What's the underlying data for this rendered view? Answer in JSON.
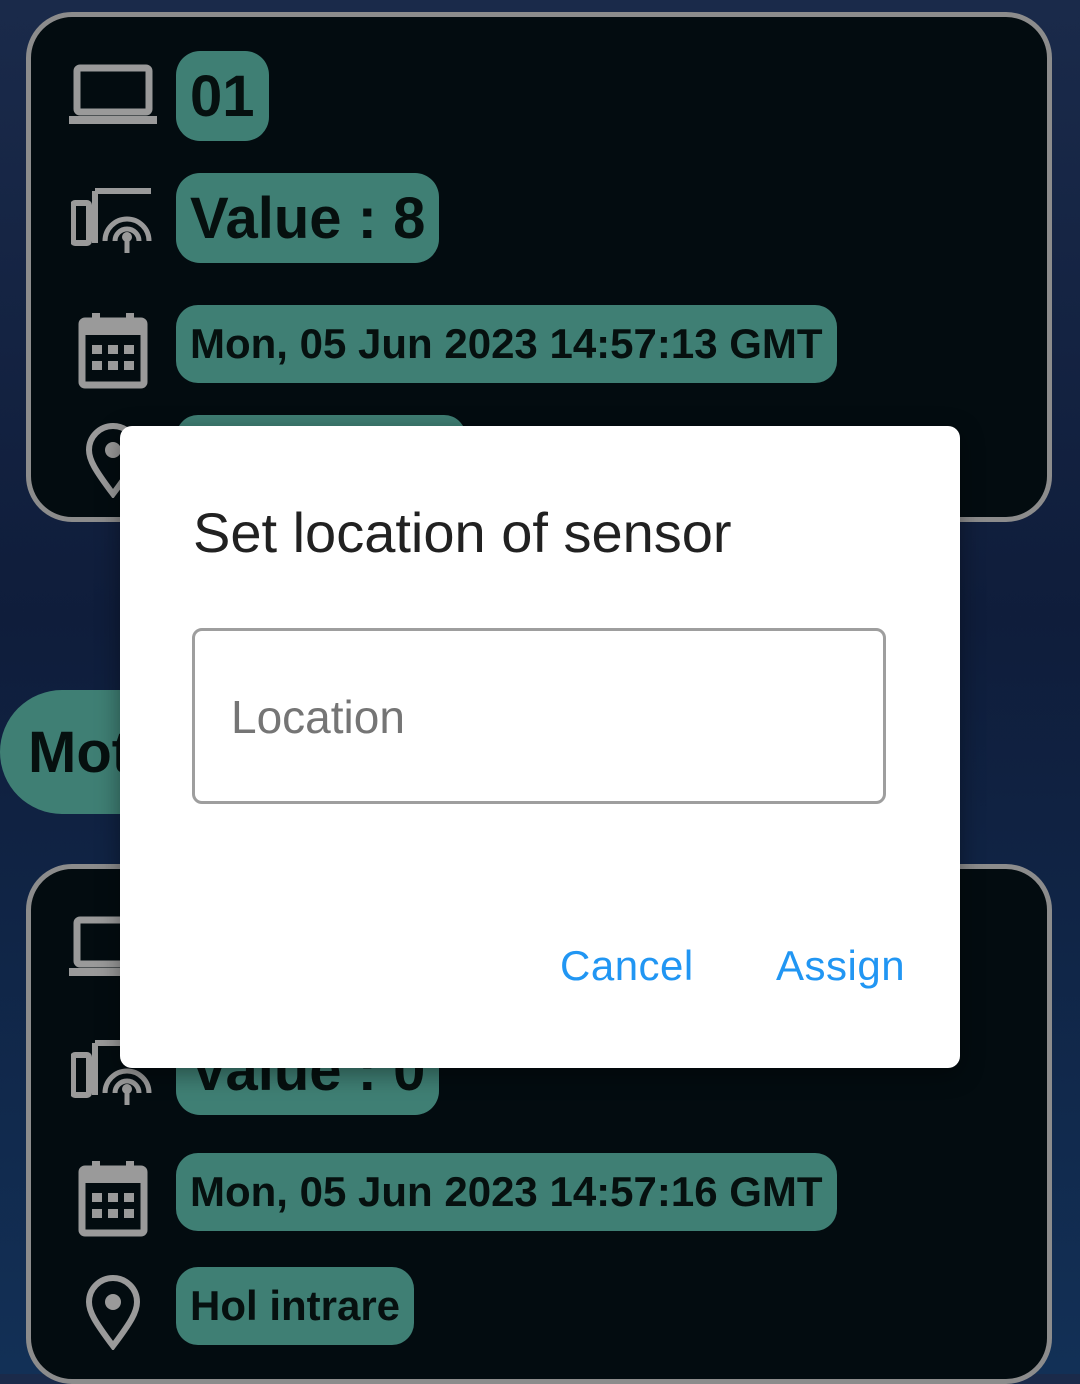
{
  "cards": [
    {
      "id_label": "01",
      "value_label": "Value : 8",
      "timestamp": "Mon, 05 Jun 2023 14:57:13 GMT",
      "location": ""
    },
    {
      "value_label": "Value : 0",
      "timestamp": "Mon, 05 Jun 2023 14:57:16 GMT",
      "location": "Hol intrare"
    }
  ],
  "section_pill": "Mot",
  "dialog": {
    "title": "Set location of sensor",
    "input_placeholder": "Location",
    "input_value": "",
    "cancel_label": "Cancel",
    "assign_label": "Assign"
  },
  "colors": {
    "pill": "#3f7f74",
    "accent": "#2196f3",
    "card_bg": "#030c10"
  },
  "icons": [
    "laptop-icon",
    "sensor-signal-icon",
    "calendar-icon",
    "location-pin-icon"
  ]
}
